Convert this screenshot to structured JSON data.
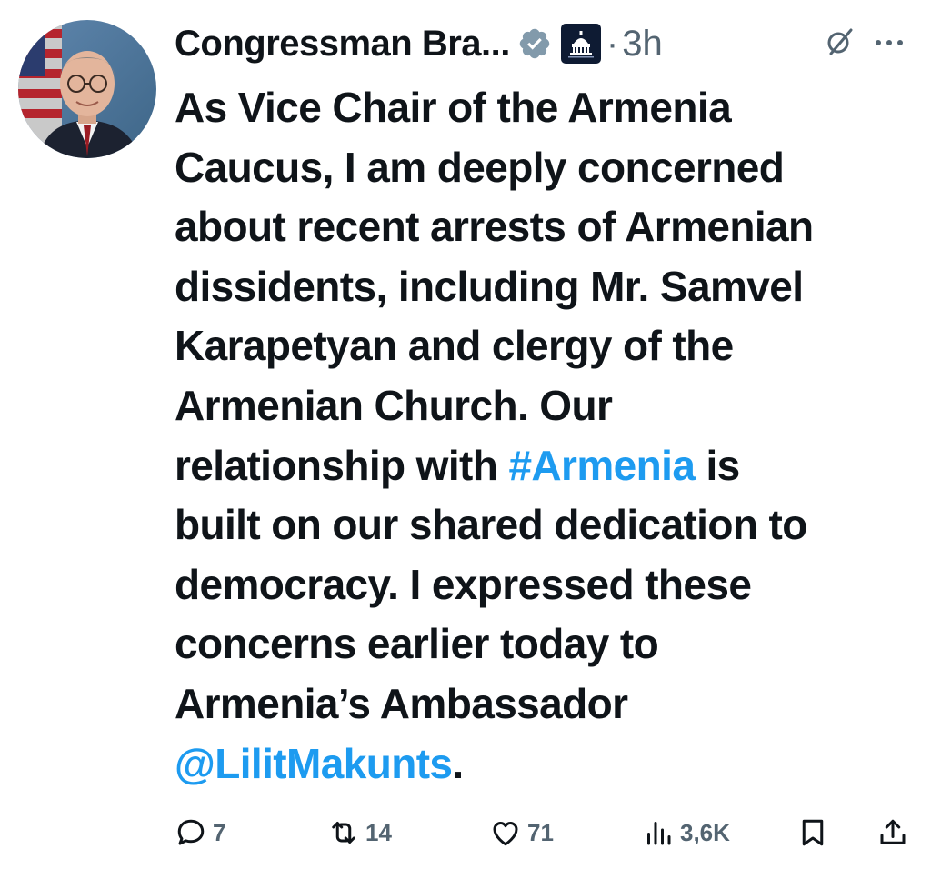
{
  "author": {
    "name": "Congressman Bra...",
    "separator": "·",
    "time": "3h"
  },
  "tweet": {
    "text_lines": [
      "As Vice Chair of the Armenia",
      "Caucus, I am deeply concerned",
      "about recent arrests of Armenian",
      "dissidents, including Mr. Samvel",
      "Karapetyan and clergy of the",
      "Armenian Church. Our",
      "relationship with "
    ],
    "hashtag": "#Armenia",
    "text_after_hashtag": " is\nbuilt on our shared dedication to\ndemocracy. I expressed these\nconcerns earlier today to\nArmenia’s Ambassador\n",
    "mention": "@LilitMakunts",
    "text_end": "."
  },
  "actions": {
    "replies": "7",
    "reposts": "14",
    "likes": "71",
    "views": "3,6K"
  },
  "icons": {
    "verified": "verified-badge-icon",
    "affiliate": "capitol-affiliate-badge-icon",
    "grok": "grok-slash-icon",
    "more": "more-dots-icon",
    "reply": "reply-bubble-icon",
    "repost": "repost-arrows-icon",
    "like": "heart-icon",
    "views": "views-bar-chart-icon",
    "bookmark": "bookmark-icon",
    "share": "share-upload-icon"
  },
  "colors": {
    "text": "#0f1419",
    "secondary": "#536471",
    "link": "#1d9bf0",
    "verified_badge": "#829aab"
  }
}
